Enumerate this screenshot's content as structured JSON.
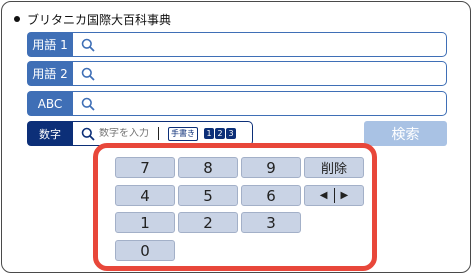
{
  "header": {
    "title": "ブリタニカ国際大百科事典"
  },
  "fields": [
    {
      "label": "用語 1",
      "value": ""
    },
    {
      "label": "用語 2",
      "value": ""
    },
    {
      "label": "ABC",
      "value": ""
    }
  ],
  "numeric": {
    "label": "数字",
    "placeholder": "数字を入力",
    "handwriting_label": "手書き",
    "keypad_icon_digits": [
      "1",
      "2",
      "3"
    ]
  },
  "search_button": "検索",
  "numpad": {
    "keys": [
      "7",
      "8",
      "9",
      "4",
      "5",
      "6",
      "1",
      "2",
      "3",
      "0"
    ],
    "delete_label": "削除",
    "arrow_left": "◀",
    "arrow_right": "▶"
  },
  "colors": {
    "field_label_bg": "#3f6fb6",
    "numeric_label_bg": "#0c2f78",
    "search_button_bg": "#a9c2e4",
    "numpad_border": "#e8473a",
    "key_bg": "#c9d3e5"
  },
  "icons": [
    "search-icon"
  ]
}
